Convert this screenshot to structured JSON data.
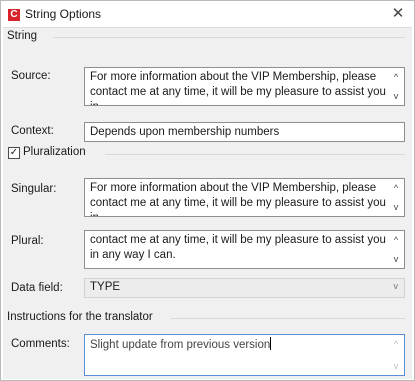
{
  "window": {
    "title": "String Options",
    "app_icon_letter": "C",
    "close_glyph": "✕"
  },
  "sections": {
    "string": "String",
    "pluralization": "Pluralization",
    "instructions": "Instructions for the translator"
  },
  "fields": {
    "source": {
      "label": "Source:",
      "value": "For more information about the VIP Membership, please contact me at any time, it will be my pleasure to assist you in"
    },
    "context": {
      "label": "Context:",
      "value": "Depends upon membership numbers"
    },
    "pluralization_checkbox": {
      "checked": true,
      "glyph": "✓"
    },
    "singular": {
      "label": "Singular:",
      "value": "For more information about the VIP Membership, please contact me at any time, it will be my pleasure to assist you in"
    },
    "plural": {
      "label": "Plural:",
      "value": "contact me at any time, it will be my pleasure to assist you in any way I can."
    },
    "data_field": {
      "label": "Data field:",
      "value": "TYPE"
    },
    "comments": {
      "label": "Comments:",
      "value": "Slight update from previous version"
    }
  },
  "icons": {
    "scroll_up": "^",
    "scroll_down": "v",
    "dropdown": "v"
  },
  "colors": {
    "app_icon": "#d9232a",
    "dialog_bg": "#f0f0f0",
    "field_border": "#8f8f8f"
  }
}
